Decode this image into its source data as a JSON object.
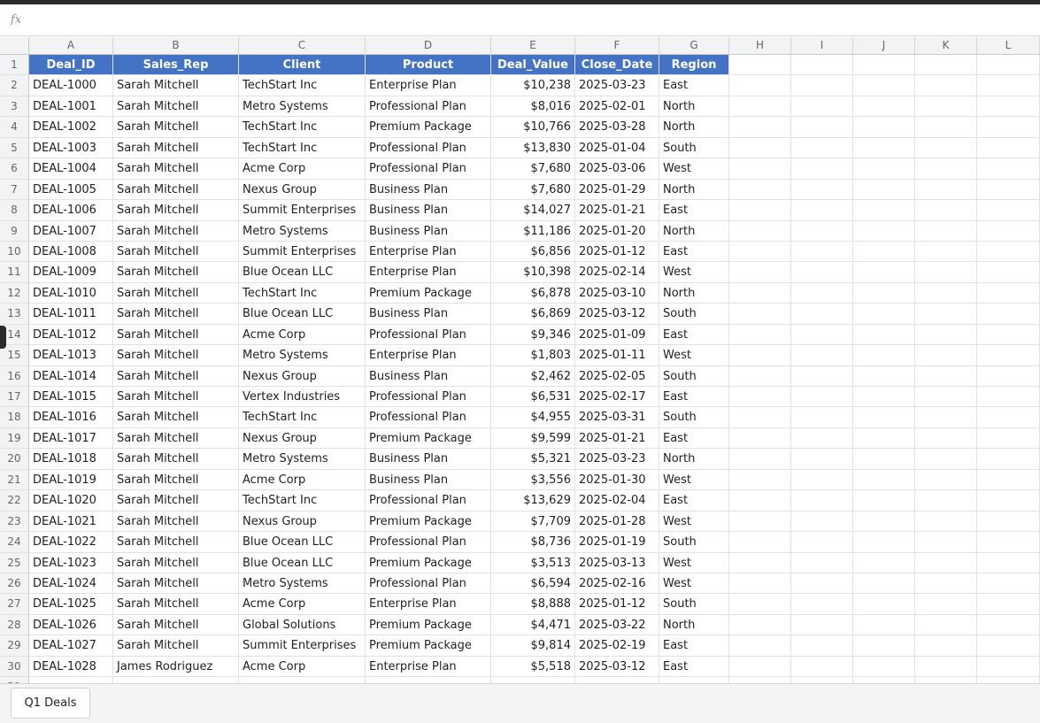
{
  "formula_bar": {
    "icon": "fx",
    "value": ""
  },
  "columns": [
    "A",
    "B",
    "C",
    "D",
    "E",
    "F",
    "G",
    "H",
    "I",
    "J",
    "K",
    "L"
  ],
  "headers": [
    "Deal_ID",
    "Sales_Rep",
    "Client",
    "Product",
    "Deal_Value",
    "Close_Date",
    "Region"
  ],
  "rows": [
    [
      "DEAL-1000",
      "Sarah Mitchell",
      "TechStart Inc",
      "Enterprise Plan",
      "$10,238",
      "2025-03-23",
      "East"
    ],
    [
      "DEAL-1001",
      "Sarah Mitchell",
      "Metro Systems",
      "Professional Plan",
      "$8,016",
      "2025-02-01",
      "North"
    ],
    [
      "DEAL-1002",
      "Sarah Mitchell",
      "TechStart Inc",
      "Premium Package",
      "$10,766",
      "2025-03-28",
      "North"
    ],
    [
      "DEAL-1003",
      "Sarah Mitchell",
      "TechStart Inc",
      "Professional Plan",
      "$13,830",
      "2025-01-04",
      "South"
    ],
    [
      "DEAL-1004",
      "Sarah Mitchell",
      "Acme Corp",
      "Professional Plan",
      "$7,680",
      "2025-03-06",
      "West"
    ],
    [
      "DEAL-1005",
      "Sarah Mitchell",
      "Nexus Group",
      "Business Plan",
      "$7,680",
      "2025-01-29",
      "North"
    ],
    [
      "DEAL-1006",
      "Sarah Mitchell",
      "Summit Enterprises",
      "Business Plan",
      "$14,027",
      "2025-01-21",
      "East"
    ],
    [
      "DEAL-1007",
      "Sarah Mitchell",
      "Metro Systems",
      "Business Plan",
      "$11,186",
      "2025-01-20",
      "North"
    ],
    [
      "DEAL-1008",
      "Sarah Mitchell",
      "Summit Enterprises",
      "Enterprise Plan",
      "$6,856",
      "2025-01-12",
      "East"
    ],
    [
      "DEAL-1009",
      "Sarah Mitchell",
      "Blue Ocean LLC",
      "Enterprise Plan",
      "$10,398",
      "2025-02-14",
      "West"
    ],
    [
      "DEAL-1010",
      "Sarah Mitchell",
      "TechStart Inc",
      "Premium Package",
      "$6,878",
      "2025-03-10",
      "North"
    ],
    [
      "DEAL-1011",
      "Sarah Mitchell",
      "Blue Ocean LLC",
      "Business Plan",
      "$6,869",
      "2025-03-12",
      "South"
    ],
    [
      "DEAL-1012",
      "Sarah Mitchell",
      "Acme Corp",
      "Professional Plan",
      "$9,346",
      "2025-01-09",
      "East"
    ],
    [
      "DEAL-1013",
      "Sarah Mitchell",
      "Metro Systems",
      "Enterprise Plan",
      "$1,803",
      "2025-01-11",
      "West"
    ],
    [
      "DEAL-1014",
      "Sarah Mitchell",
      "Nexus Group",
      "Business Plan",
      "$2,462",
      "2025-02-05",
      "South"
    ],
    [
      "DEAL-1015",
      "Sarah Mitchell",
      "Vertex Industries",
      "Professional Plan",
      "$6,531",
      "2025-02-17",
      "East"
    ],
    [
      "DEAL-1016",
      "Sarah Mitchell",
      "TechStart Inc",
      "Professional Plan",
      "$4,955",
      "2025-03-31",
      "South"
    ],
    [
      "DEAL-1017",
      "Sarah Mitchell",
      "Nexus Group",
      "Premium Package",
      "$9,599",
      "2025-01-21",
      "East"
    ],
    [
      "DEAL-1018",
      "Sarah Mitchell",
      "Metro Systems",
      "Business Plan",
      "$5,321",
      "2025-03-23",
      "North"
    ],
    [
      "DEAL-1019",
      "Sarah Mitchell",
      "Acme Corp",
      "Business Plan",
      "$3,556",
      "2025-01-30",
      "West"
    ],
    [
      "DEAL-1020",
      "Sarah Mitchell",
      "TechStart Inc",
      "Professional Plan",
      "$13,629",
      "2025-02-04",
      "East"
    ],
    [
      "DEAL-1021",
      "Sarah Mitchell",
      "Nexus Group",
      "Premium Package",
      "$7,709",
      "2025-01-28",
      "West"
    ],
    [
      "DEAL-1022",
      "Sarah Mitchell",
      "Blue Ocean LLC",
      "Professional Plan",
      "$8,736",
      "2025-01-19",
      "South"
    ],
    [
      "DEAL-1023",
      "Sarah Mitchell",
      "Blue Ocean LLC",
      "Premium Package",
      "$3,513",
      "2025-03-13",
      "West"
    ],
    [
      "DEAL-1024",
      "Sarah Mitchell",
      "Metro Systems",
      "Professional Plan",
      "$6,594",
      "2025-02-16",
      "West"
    ],
    [
      "DEAL-1025",
      "Sarah Mitchell",
      "Acme Corp",
      "Enterprise Plan",
      "$8,888",
      "2025-01-12",
      "South"
    ],
    [
      "DEAL-1026",
      "Sarah Mitchell",
      "Global Solutions",
      "Premium Package",
      "$4,471",
      "2025-03-22",
      "North"
    ],
    [
      "DEAL-1027",
      "Sarah Mitchell",
      "Summit Enterprises",
      "Premium Package",
      "$9,814",
      "2025-02-19",
      "East"
    ],
    [
      "DEAL-1028",
      "James Rodriguez",
      "Acme Corp",
      "Enterprise Plan",
      "$5,518",
      "2025-03-12",
      "East"
    ]
  ],
  "sheet_tabs": [
    "Q1 Deals"
  ],
  "colors": {
    "header_fill": "#4472c4",
    "header_text": "#ffffff"
  }
}
